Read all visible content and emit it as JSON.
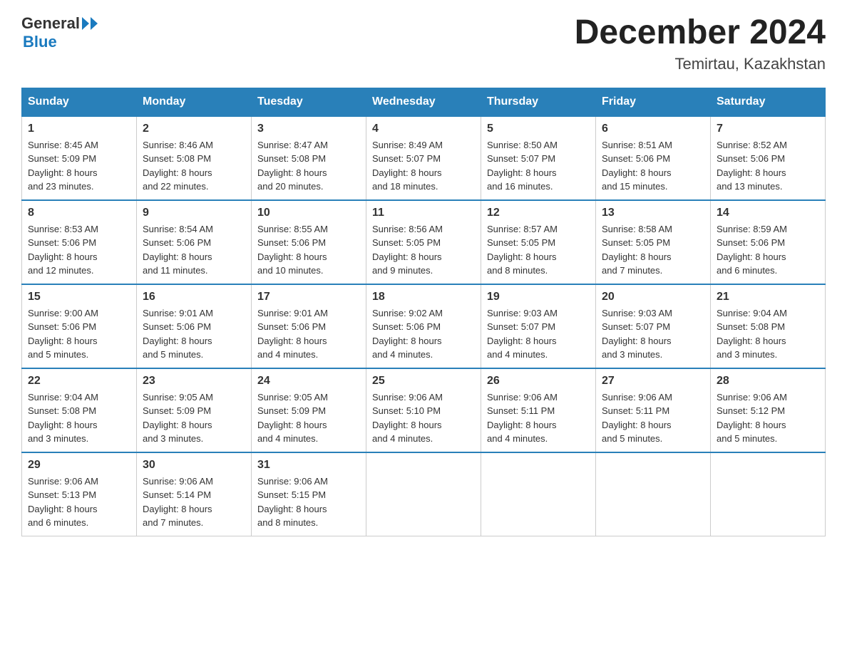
{
  "header": {
    "month_year": "December 2024",
    "location": "Temirtau, Kazakhstan",
    "logo_general": "General",
    "logo_blue": "Blue"
  },
  "days_of_week": [
    "Sunday",
    "Monday",
    "Tuesday",
    "Wednesday",
    "Thursday",
    "Friday",
    "Saturday"
  ],
  "weeks": [
    [
      {
        "day": "1",
        "sunrise": "8:45 AM",
        "sunset": "5:09 PM",
        "daylight": "8 hours and 23 minutes."
      },
      {
        "day": "2",
        "sunrise": "8:46 AM",
        "sunset": "5:08 PM",
        "daylight": "8 hours and 22 minutes."
      },
      {
        "day": "3",
        "sunrise": "8:47 AM",
        "sunset": "5:08 PM",
        "daylight": "8 hours and 20 minutes."
      },
      {
        "day": "4",
        "sunrise": "8:49 AM",
        "sunset": "5:07 PM",
        "daylight": "8 hours and 18 minutes."
      },
      {
        "day": "5",
        "sunrise": "8:50 AM",
        "sunset": "5:07 PM",
        "daylight": "8 hours and 16 minutes."
      },
      {
        "day": "6",
        "sunrise": "8:51 AM",
        "sunset": "5:06 PM",
        "daylight": "8 hours and 15 minutes."
      },
      {
        "day": "7",
        "sunrise": "8:52 AM",
        "sunset": "5:06 PM",
        "daylight": "8 hours and 13 minutes."
      }
    ],
    [
      {
        "day": "8",
        "sunrise": "8:53 AM",
        "sunset": "5:06 PM",
        "daylight": "8 hours and 12 minutes."
      },
      {
        "day": "9",
        "sunrise": "8:54 AM",
        "sunset": "5:06 PM",
        "daylight": "8 hours and 11 minutes."
      },
      {
        "day": "10",
        "sunrise": "8:55 AM",
        "sunset": "5:06 PM",
        "daylight": "8 hours and 10 minutes."
      },
      {
        "day": "11",
        "sunrise": "8:56 AM",
        "sunset": "5:05 PM",
        "daylight": "8 hours and 9 minutes."
      },
      {
        "day": "12",
        "sunrise": "8:57 AM",
        "sunset": "5:05 PM",
        "daylight": "8 hours and 8 minutes."
      },
      {
        "day": "13",
        "sunrise": "8:58 AM",
        "sunset": "5:05 PM",
        "daylight": "8 hours and 7 minutes."
      },
      {
        "day": "14",
        "sunrise": "8:59 AM",
        "sunset": "5:06 PM",
        "daylight": "8 hours and 6 minutes."
      }
    ],
    [
      {
        "day": "15",
        "sunrise": "9:00 AM",
        "sunset": "5:06 PM",
        "daylight": "8 hours and 5 minutes."
      },
      {
        "day": "16",
        "sunrise": "9:01 AM",
        "sunset": "5:06 PM",
        "daylight": "8 hours and 5 minutes."
      },
      {
        "day": "17",
        "sunrise": "9:01 AM",
        "sunset": "5:06 PM",
        "daylight": "8 hours and 4 minutes."
      },
      {
        "day": "18",
        "sunrise": "9:02 AM",
        "sunset": "5:06 PM",
        "daylight": "8 hours and 4 minutes."
      },
      {
        "day": "19",
        "sunrise": "9:03 AM",
        "sunset": "5:07 PM",
        "daylight": "8 hours and 4 minutes."
      },
      {
        "day": "20",
        "sunrise": "9:03 AM",
        "sunset": "5:07 PM",
        "daylight": "8 hours and 3 minutes."
      },
      {
        "day": "21",
        "sunrise": "9:04 AM",
        "sunset": "5:08 PM",
        "daylight": "8 hours and 3 minutes."
      }
    ],
    [
      {
        "day": "22",
        "sunrise": "9:04 AM",
        "sunset": "5:08 PM",
        "daylight": "8 hours and 3 minutes."
      },
      {
        "day": "23",
        "sunrise": "9:05 AM",
        "sunset": "5:09 PM",
        "daylight": "8 hours and 3 minutes."
      },
      {
        "day": "24",
        "sunrise": "9:05 AM",
        "sunset": "5:09 PM",
        "daylight": "8 hours and 4 minutes."
      },
      {
        "day": "25",
        "sunrise": "9:06 AM",
        "sunset": "5:10 PM",
        "daylight": "8 hours and 4 minutes."
      },
      {
        "day": "26",
        "sunrise": "9:06 AM",
        "sunset": "5:11 PM",
        "daylight": "8 hours and 4 minutes."
      },
      {
        "day": "27",
        "sunrise": "9:06 AM",
        "sunset": "5:11 PM",
        "daylight": "8 hours and 5 minutes."
      },
      {
        "day": "28",
        "sunrise": "9:06 AM",
        "sunset": "5:12 PM",
        "daylight": "8 hours and 5 minutes."
      }
    ],
    [
      {
        "day": "29",
        "sunrise": "9:06 AM",
        "sunset": "5:13 PM",
        "daylight": "8 hours and 6 minutes."
      },
      {
        "day": "30",
        "sunrise": "9:06 AM",
        "sunset": "5:14 PM",
        "daylight": "8 hours and 7 minutes."
      },
      {
        "day": "31",
        "sunrise": "9:06 AM",
        "sunset": "5:15 PM",
        "daylight": "8 hours and 8 minutes."
      },
      null,
      null,
      null,
      null
    ]
  ],
  "labels": {
    "sunrise": "Sunrise:",
    "sunset": "Sunset:",
    "daylight": "Daylight:"
  }
}
